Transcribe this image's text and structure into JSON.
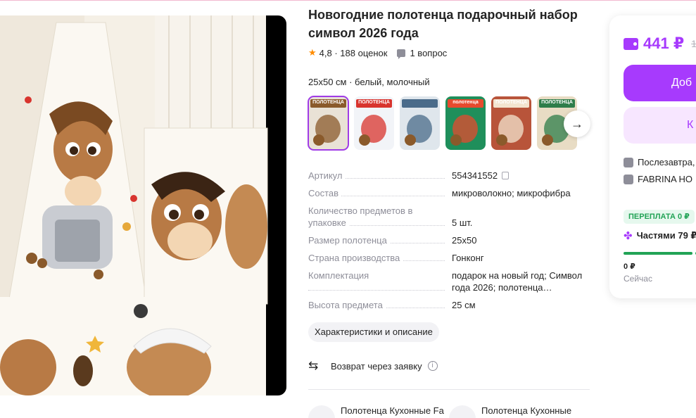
{
  "product": {
    "title": "Новогодние полотенца подарочный набор символ 2026 года",
    "rating": "4,8",
    "reviews": "188 оценок",
    "questions": "1 вопрос",
    "variant": "25x50 см · белый, молочный"
  },
  "gallery": {
    "main_image": "product-photo-towels-horse-chef",
    "thumbnails": [
      {
        "caption": "ПОЛОТЕНЦА",
        "colors": [
          "#e9e2d6",
          "#8a5a2b"
        ]
      },
      {
        "caption": "ПОЛОТЕНЦА",
        "colors": [
          "#f2f4f8",
          "#d8342e"
        ]
      },
      {
        "caption": "",
        "colors": [
          "#dfe6ec",
          "#4a6b8a"
        ]
      },
      {
        "caption": "полотенца",
        "colors": [
          "#1f8f5b",
          "#e64a2e"
        ]
      },
      {
        "caption": "ПОЛОТЕНЦА",
        "colors": [
          "#b8543a",
          "#f3e4cf"
        ]
      },
      {
        "caption": "ПОЛОТЕНЦА",
        "colors": [
          "#e8dcc4",
          "#2e7d4a"
        ]
      }
    ]
  },
  "specs": [
    {
      "key": "Артикул",
      "value": "554341552"
    },
    {
      "key": "Состав",
      "value": "микроволокно; микрофибра"
    },
    {
      "key": "Количество предметов в упаковке",
      "value": "5 шт."
    },
    {
      "key": "Размер полотенца",
      "value": "25x50"
    },
    {
      "key": "Страна производства",
      "value": "Гонконг"
    },
    {
      "key": "Комплектация",
      "value": "подарок на новый год; Символ года 2026; полотенца…"
    },
    {
      "key": "Высота предмета",
      "value": "25 см"
    }
  ],
  "description_button": "Характеристики и описание",
  "return": {
    "label": "Возврат через заявку"
  },
  "related": [
    {
      "label": "Полотенца Кухонные Fa"
    },
    {
      "label": "Полотенца Кухонные"
    }
  ],
  "buy_card": {
    "price": "441 ₽",
    "old_price": "1",
    "add_label": "Доб",
    "buy_label": "К",
    "delivery": "Послезавтра,",
    "seller": "FABRINA HO",
    "overpay": "ПЕРЕПЛАТА 0 ₽",
    "parts": "Частями 79 ₽",
    "now_amount": "0 ₽",
    "now_label": "Сейчас",
    "accent": "#a73afd",
    "success": "#21a355"
  }
}
